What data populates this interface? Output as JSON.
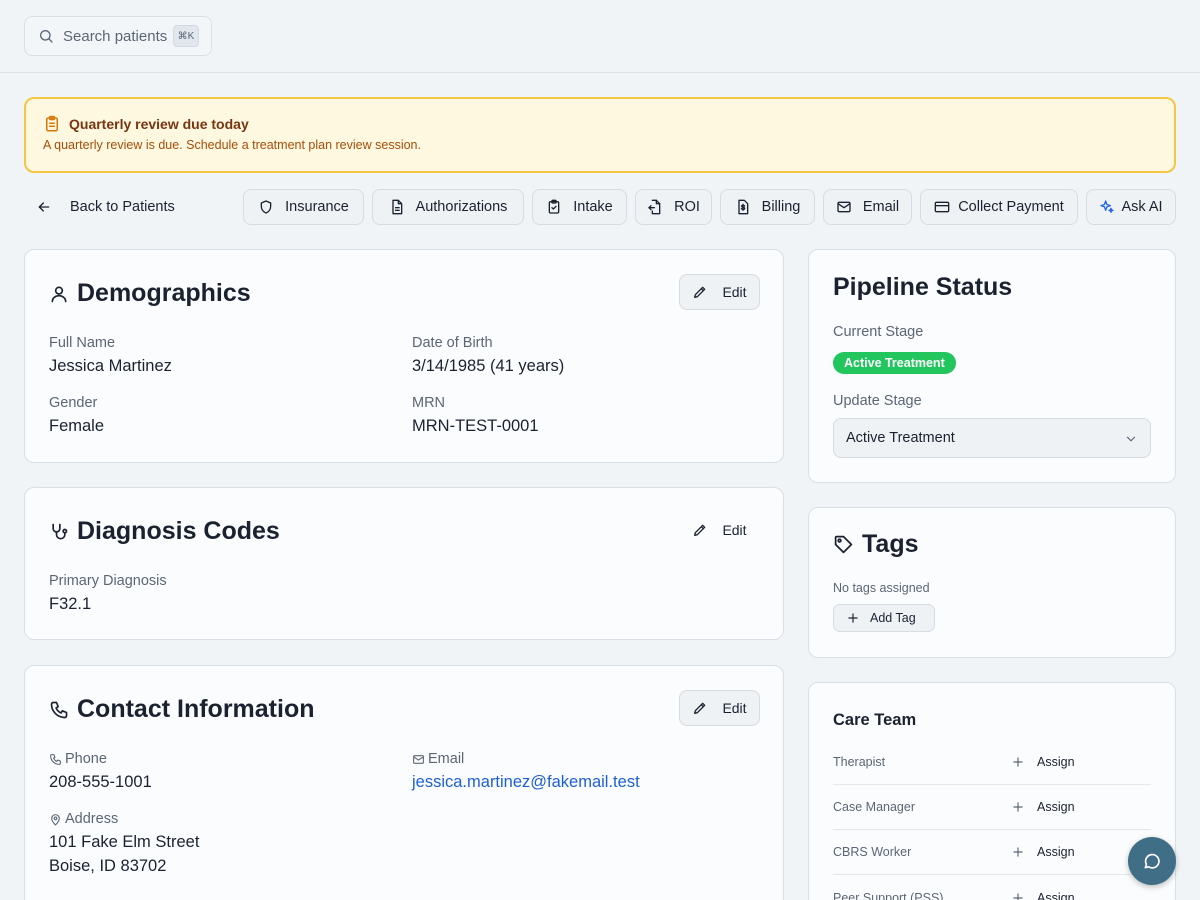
{
  "search": {
    "placeholder": "Search patients",
    "shortcut": "⌘K"
  },
  "alert": {
    "title": "Quarterly review due today",
    "message": "A quarterly review is due. Schedule a treatment plan review session."
  },
  "nav": {
    "back_label": "Back to Patients"
  },
  "actions": [
    {
      "label": "Insurance",
      "icon": "shield-icon"
    },
    {
      "label": "Authorizations",
      "icon": "document-icon"
    },
    {
      "label": "Intake",
      "icon": "clipboard-icon"
    },
    {
      "label": "ROI",
      "icon": "file-transfer-icon"
    },
    {
      "label": "Billing",
      "icon": "invoice-icon"
    },
    {
      "label": "Email",
      "icon": "mail-icon"
    },
    {
      "label": "Collect Payment",
      "icon": "credit-card-icon"
    },
    {
      "label": "Ask AI",
      "icon": "sparkles-icon"
    }
  ],
  "demographics": {
    "title": "Demographics",
    "edit_label": "Edit",
    "full_name_label": "Full Name",
    "full_name": "Jessica Martinez",
    "dob_label": "Date of Birth",
    "dob": "3/14/1985 (41 years)",
    "gender_label": "Gender",
    "gender": "Female",
    "mrn_label": "MRN",
    "mrn": "MRN-TEST-0001"
  },
  "diagnosis": {
    "title": "Diagnosis Codes",
    "edit_label": "Edit",
    "primary_label": "Primary Diagnosis",
    "primary": "F32.1"
  },
  "contact": {
    "title": "Contact Information",
    "edit_label": "Edit",
    "phone_label": "Phone",
    "phone": "208-555-1001",
    "email_label": "Email",
    "email": "jessica.martinez@fakemail.test",
    "address_label": "Address",
    "address_line1": "101 Fake Elm Street",
    "address_line2": "Boise, ID 83702"
  },
  "pipeline": {
    "title": "Pipeline Status",
    "current_stage_label": "Current Stage",
    "current_stage": "Active Treatment",
    "update_stage_label": "Update Stage",
    "update_stage_value": "Active Treatment"
  },
  "tags": {
    "title": "Tags",
    "empty_text": "No tags assigned",
    "add_label": "Add Tag"
  },
  "care_team": {
    "title": "Care Team",
    "assign_label": "Assign",
    "roles": [
      "Therapist",
      "Case Manager",
      "CBRS Worker",
      "Peer Support (PSS)"
    ]
  },
  "colors": {
    "accent_green": "#22c55e",
    "alert_border": "#f5c544",
    "link": "#1d5fd6",
    "chat_button": "#3f6e86"
  }
}
